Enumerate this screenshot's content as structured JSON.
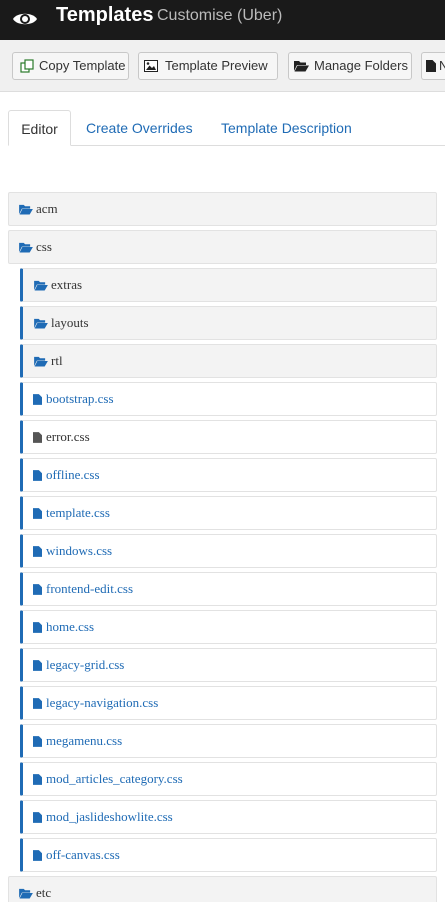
{
  "header": {
    "title": "Templates",
    "subtitle": "Customise (Uber)"
  },
  "toolbar": {
    "copy_label": "Copy Template",
    "preview_label": "Template Preview",
    "folders_label": "Manage Folders",
    "new_label": "N"
  },
  "tabs": [
    {
      "label": "Editor",
      "active": true
    },
    {
      "label": "Create Overrides",
      "active": false
    },
    {
      "label": "Template Description",
      "active": false
    }
  ],
  "tree": {
    "top_folders": [
      "acm",
      "css",
      "etc"
    ],
    "css_subfolders": [
      "extras",
      "layouts",
      "rtl"
    ],
    "css_files": [
      {
        "name": "bootstrap.css",
        "status": "link"
      },
      {
        "name": "error.css",
        "status": "dark"
      },
      {
        "name": "offline.css",
        "status": "link"
      },
      {
        "name": "template.css",
        "status": "link"
      },
      {
        "name": "windows.css",
        "status": "link"
      },
      {
        "name": "frontend-edit.css",
        "status": "link"
      },
      {
        "name": "home.css",
        "status": "link"
      },
      {
        "name": "legacy-grid.css",
        "status": "link"
      },
      {
        "name": "legacy-navigation.css",
        "status": "link"
      },
      {
        "name": "megamenu.css",
        "status": "link"
      },
      {
        "name": "mod_articles_category.css",
        "status": "link"
      },
      {
        "name": "mod_jaslideshowlite.css",
        "status": "link"
      },
      {
        "name": "off-canvas.css",
        "status": "link"
      }
    ]
  },
  "colors": {
    "header_bg": "#1a1a1a",
    "link": "#1f6bb5",
    "folder_bg": "#f3f3f3",
    "dark_text": "#333333"
  },
  "icons": {
    "header": "eye-icon",
    "copy": "copy-icon",
    "preview": "image-icon",
    "folders": "folder-open-icon",
    "new": "file-icon",
    "folder": "folder-open-icon",
    "file": "file-icon"
  }
}
